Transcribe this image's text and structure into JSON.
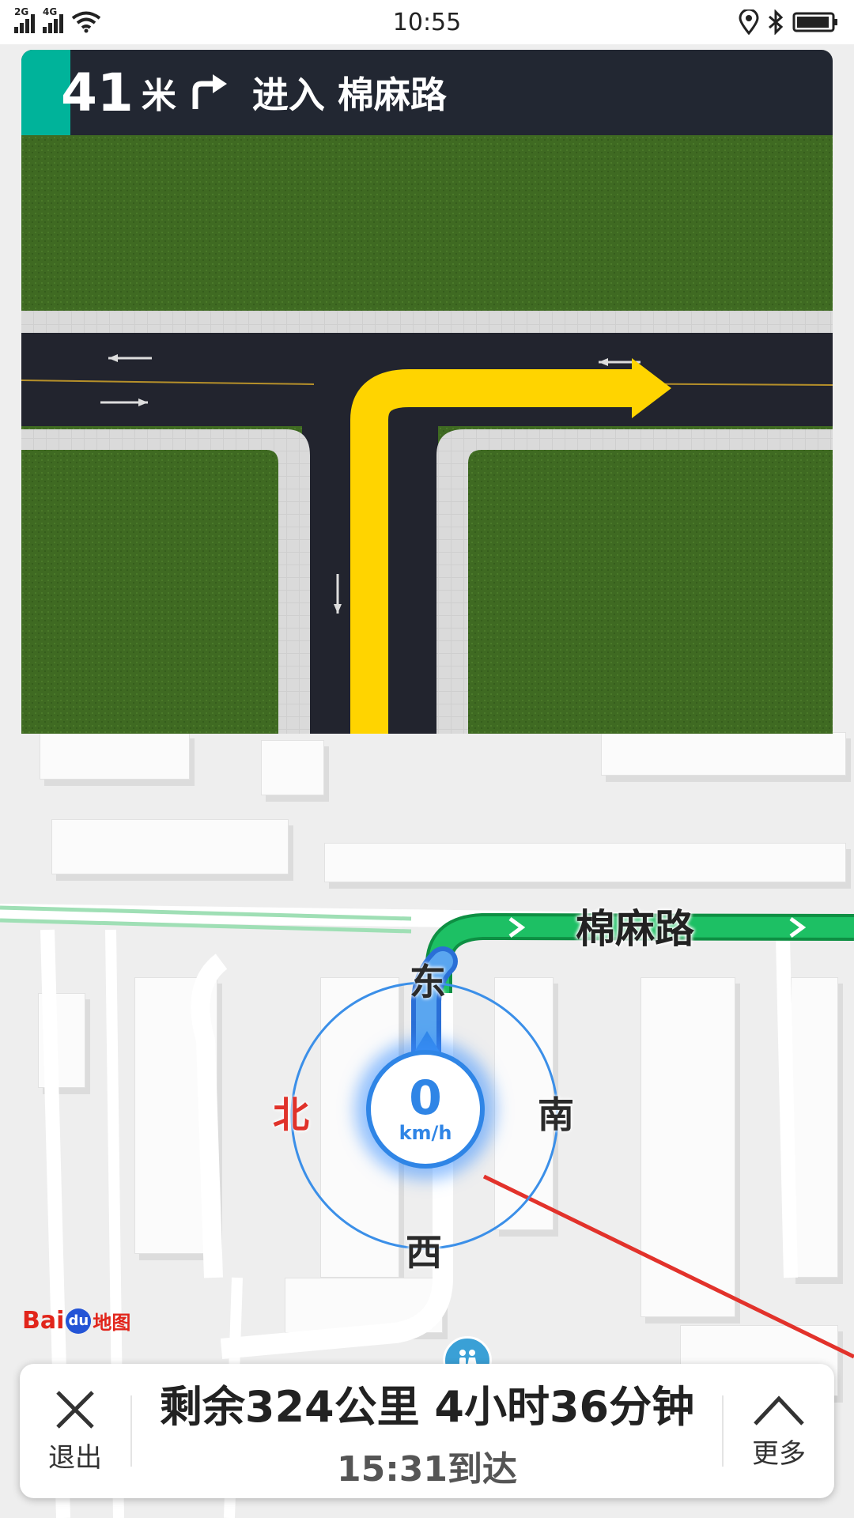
{
  "status_bar": {
    "time": "10:55",
    "signal_1_tag": "2G",
    "signal_2_tag": "4G",
    "icons": [
      "signal-icon",
      "wifi-icon",
      "location-icon",
      "bluetooth-icon",
      "battery-icon"
    ]
  },
  "guidance": {
    "distance": "41",
    "unit": "米",
    "turn_icon": "turn-right-icon",
    "road_instruction": "进入 棉麻路"
  },
  "map": {
    "road_name": "棉麻路",
    "compass": {
      "east": "东",
      "north": "北",
      "south": "南",
      "west": "西"
    },
    "speed": {
      "value": "0",
      "unit": "km/h"
    },
    "logo": {
      "bai": "Bai",
      "du": "du",
      "ditu": "地图"
    },
    "poi_icon": "restroom-icon"
  },
  "bottom_panel": {
    "exit_label": "退出",
    "remaining": "剩余324公里 4小时36分钟",
    "eta": "15:31到达",
    "more_label": "更多"
  },
  "colors": {
    "header_bg": "#222732",
    "accent": "#00b39a",
    "route_green": "#17b35a",
    "route_blue": "#3b8fe8",
    "arrow_yellow": "#ffd400",
    "grass": "#3f6a22",
    "north_red": "#e0322a"
  }
}
